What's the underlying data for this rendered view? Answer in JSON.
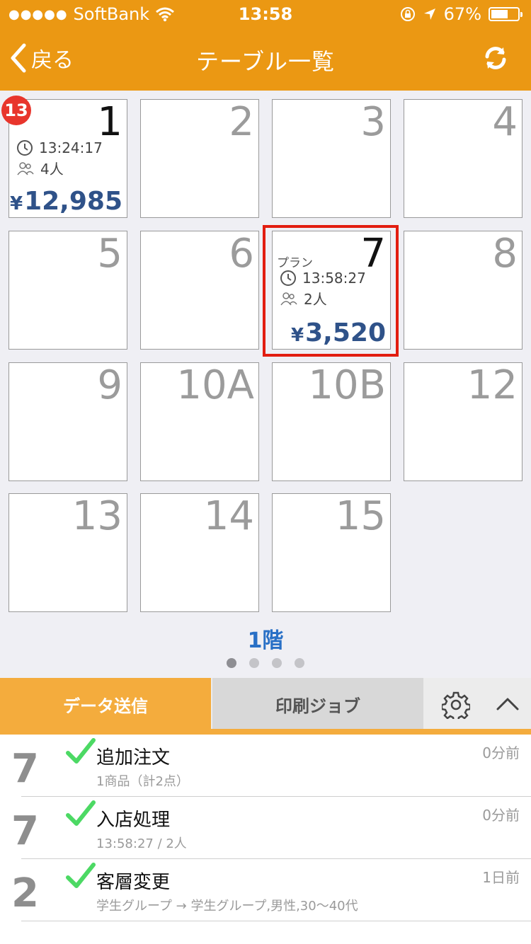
{
  "status_bar": {
    "signal": "●●●●●",
    "carrier": "SoftBank",
    "time": "13:58",
    "battery": "67%",
    "battery_level": 0.67
  },
  "nav": {
    "back_label": "戻る",
    "title": "テーブル一覧"
  },
  "tables": [
    {
      "label": "1",
      "badge": "13",
      "time": "13:24:17",
      "guests": "4人",
      "amount": "12,985"
    },
    {
      "label": "2"
    },
    {
      "label": "3"
    },
    {
      "label": "4"
    },
    {
      "label": "5"
    },
    {
      "label": "6"
    },
    {
      "label": "7",
      "plan": "プラン",
      "time": "13:58:27",
      "guests": "2人",
      "amount": "3,520"
    },
    {
      "label": "8"
    },
    {
      "label": "9"
    },
    {
      "label": "10A"
    },
    {
      "label": "10B"
    },
    {
      "label": "12"
    },
    {
      "label": "13"
    },
    {
      "label": "14"
    },
    {
      "label": "15"
    }
  ],
  "currency": "¥",
  "floor": "1階",
  "tabs": {
    "data_send": "データ送信",
    "print_job": "印刷ジョブ"
  },
  "history": [
    {
      "table": "7",
      "title": "追加注文",
      "sub": "1商品（計2点）",
      "ago": "0分前"
    },
    {
      "table": "7",
      "title": "入店処理",
      "sub": "13:58:27 / 2人",
      "ago": "0分前"
    },
    {
      "table": "2",
      "title": "客層変更",
      "sub": "学生グループ → 学生グループ,男性,30〜40代",
      "ago": "1日前"
    }
  ],
  "colors": {
    "header": "#EB9813",
    "tab_active": "#F4AC3D",
    "amount": "#2F5289",
    "highlight": "#E21D10",
    "badge": "#E8352C",
    "check": "#4CD964"
  }
}
